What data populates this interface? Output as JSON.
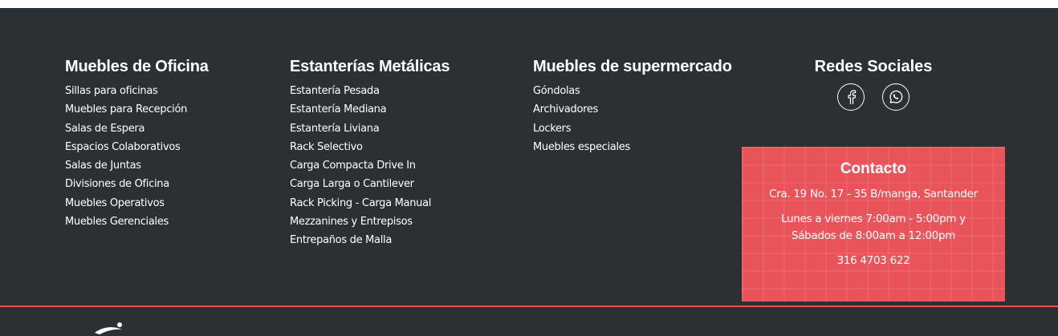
{
  "footer": {
    "col1": {
      "title": "Muebles de Oficina",
      "links": [
        "Sillas para oficinas",
        "Muebles para Recepción",
        "Salas de Espera",
        "Espacios Colaborativos",
        "Salas de Juntas",
        "Divisiones de Oficina",
        "Muebles Operativos",
        "Muebles Gerenciales"
      ]
    },
    "col2": {
      "title": "Estanterías Metálicas",
      "links": [
        "Estantería Pesada",
        "Estantería Mediana",
        "Estantería Liviana",
        "Rack Selectivo",
        "Carga Compacta Drive In",
        "Carga Larga o Cantilever",
        "Rack Picking - Carga Manual",
        "Mezzanines y Entrepisos",
        "Entrepaños de Malla"
      ]
    },
    "col3": {
      "title": "Muebles de supermercado",
      "links": [
        "Góndolas",
        "Archivadores",
        "Lockers",
        "Muebles especiales"
      ]
    },
    "social": {
      "title": "Redes Sociales",
      "icons": [
        "facebook-icon",
        "whatsapp-icon"
      ]
    },
    "contact": {
      "title": "Contacto",
      "address": "Cra. 19 No. 17 - 35 B/manga, Santander",
      "hours_line1": "Lunes a viernes 7:00am - 5:00pm y",
      "hours_line2": "Sábados de 8:00am a 12:00pm",
      "phone": "316 4703 622"
    },
    "colors": {
      "background": "#2d3033",
      "accent": "#e9545a",
      "divider": "#e94a4a"
    }
  }
}
